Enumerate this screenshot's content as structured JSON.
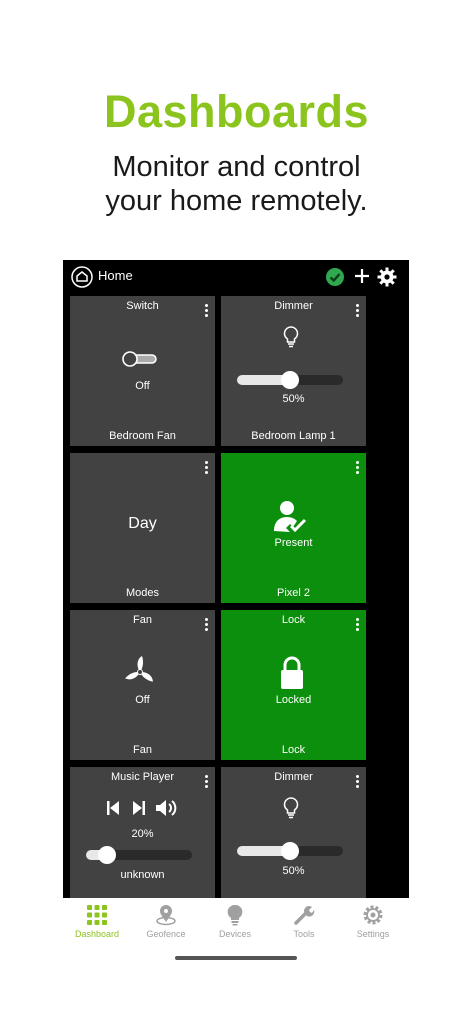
{
  "promo": {
    "headline": "Dashboards",
    "subline_1": "Monitor and control",
    "subline_2": "your home remotely."
  },
  "appbar": {
    "title": "Home"
  },
  "tiles": [
    {
      "type": "Switch",
      "name": "Bedroom Fan",
      "status": "Off",
      "icon": "switch-icon"
    },
    {
      "type": "Dimmer",
      "name": "Bedroom Lamp 1",
      "status": "50%",
      "level": 0.5,
      "icon": "bulb-icon"
    },
    {
      "type": "",
      "name": "Modes",
      "status": "Day"
    },
    {
      "type": "",
      "name": "Pixel 2",
      "status": "Present",
      "icon": "presence-icon"
    },
    {
      "type": "Fan",
      "name": "Fan",
      "status": "Off",
      "icon": "fan-icon"
    },
    {
      "type": "Lock",
      "name": "Lock",
      "status": "Locked",
      "icon": "padlock-icon"
    },
    {
      "type": "Music Player",
      "name": "unknown",
      "status": "20%",
      "level": 0.2,
      "icon": "media-controls-icon"
    },
    {
      "type": "Dimmer",
      "name": "",
      "status": "50%",
      "level": 0.5,
      "icon": "bulb-icon"
    }
  ],
  "nav": [
    {
      "label": "Dashboard",
      "icon": "dashboard-icon",
      "active": true
    },
    {
      "label": "Geofence",
      "icon": "geofence-icon"
    },
    {
      "label": "Devices",
      "icon": "devices-icon"
    },
    {
      "label": "Tools",
      "icon": "tools-icon"
    },
    {
      "label": "Settings",
      "icon": "settings-icon"
    }
  ],
  "colors": {
    "accent": "#8cc41e",
    "tile": "#424242",
    "tile_active": "#0c8f0c",
    "status_ok": "#2fa84f"
  }
}
